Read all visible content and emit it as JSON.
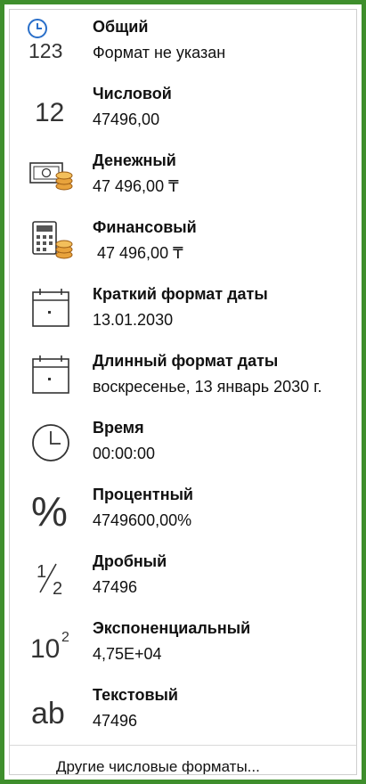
{
  "formats": [
    {
      "icon": "general-format-icon",
      "title": "Общий",
      "value": "Формат не указан",
      "glyph": "123"
    },
    {
      "icon": "number-format-icon",
      "title": "Числовой",
      "value": "47496,00",
      "glyph": "12"
    },
    {
      "icon": "currency-format-icon",
      "title": "Денежный",
      "value": "47 496,00 ₸"
    },
    {
      "icon": "accounting-format-icon",
      "title": "Финансовый",
      "value": " 47 496,00 ₸"
    },
    {
      "icon": "calendar-icon",
      "title": "Краткий формат даты",
      "value": "13.01.2030"
    },
    {
      "icon": "calendar-icon",
      "title": "Длинный формат даты",
      "value": "воскресенье, 13 январь 2030 г."
    },
    {
      "icon": "clock-icon",
      "title": "Время",
      "value": "00:00:00"
    },
    {
      "icon": "percent-icon",
      "title": "Процентный",
      "value": "4749600,00%",
      "glyph": "%"
    },
    {
      "icon": "fraction-icon",
      "title": "Дробный",
      "value": "47496",
      "glyph_num": "1",
      "glyph_den": "2"
    },
    {
      "icon": "scientific-icon",
      "title": "Экспоненциальный",
      "value": "4,75E+04",
      "glyph_base": "10",
      "glyph_exp": "2"
    },
    {
      "icon": "text-format-icon",
      "title": "Текстовый",
      "value": "47496",
      "glyph": "ab"
    }
  ],
  "footer": {
    "label": "Другие числовые форматы..."
  },
  "colors": {
    "frame": "#3e8e2c",
    "coin": "#e8a33c",
    "clock_blue": "#2a6fc9"
  }
}
